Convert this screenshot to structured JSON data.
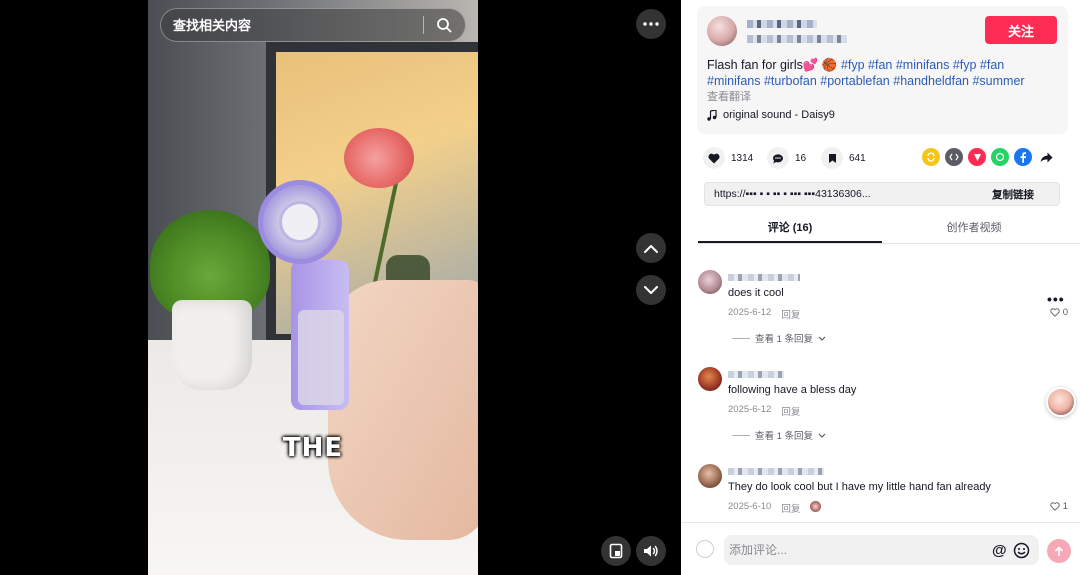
{
  "video": {
    "search_placeholder": "查找相关内容",
    "caption": "THE"
  },
  "author": {
    "follow_label": "关注"
  },
  "post": {
    "desc_plain": "Flash fan for girls💕 🏀 ",
    "hashtags_line1": "#fyp #fan #minifans #fyp #fan",
    "hashtags_line2": "#minifans #turbofan #portablefan #handheldfan #summer",
    "translate_label": "查看翻译",
    "music": "original sound - Daisy9"
  },
  "stats": {
    "likes": "1314",
    "comments": "16",
    "saves": "641"
  },
  "share": {
    "link_url": "https://▪▪▪ ▪  ▪ ▪▪  ▪ ▪▪▪ ▪▪▪43136306...",
    "copy_label": "复制链接"
  },
  "tabs": {
    "comments_label": "评论 (16)",
    "creator_videos_label": "创作者视频"
  },
  "comments": [
    {
      "text": "does it cool",
      "date": "2025-6-12",
      "reply_label": "回复",
      "like_count": "0",
      "view_replies": "查看 1 条回复"
    },
    {
      "text": "following have a bless day",
      "date": "2025-6-12",
      "reply_label": "回复",
      "view_replies": "查看 1 条回复"
    },
    {
      "text": "They do look cool but I have my little hand fan already",
      "date": "2025-6-10",
      "reply_label": "回复",
      "like_count": "1"
    }
  ],
  "composer": {
    "placeholder": "添加评论...",
    "mention_symbol": "@"
  },
  "colors": {
    "follow": "#fe2c55",
    "hashtag": "#2b5db9",
    "send_disabled": "#f7a8b7"
  },
  "icons": {
    "share": [
      "repost-icon",
      "embed-icon",
      "send-to-friend-icon",
      "whatsapp-icon",
      "facebook-icon",
      "more-share-icon"
    ]
  }
}
